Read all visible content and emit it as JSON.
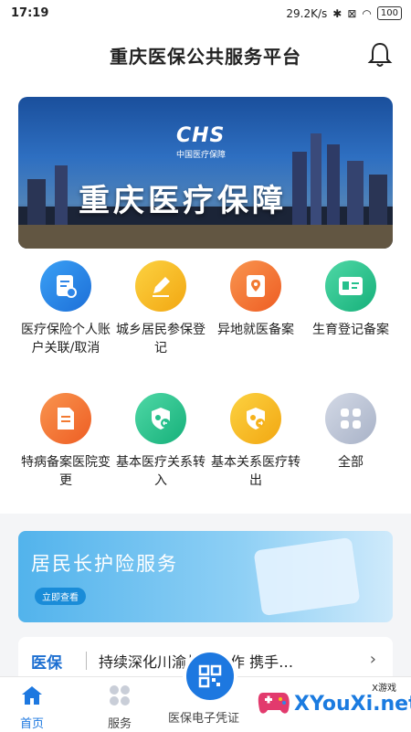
{
  "status_bar": {
    "time": "17:19",
    "speed": "29.2K/s",
    "battery": "100"
  },
  "header": {
    "title": "重庆医保公共服务平台"
  },
  "banner": {
    "logo": "CHS",
    "logo_sub": "中国医疗保障",
    "headline": "重庆医疗保障"
  },
  "services": [
    {
      "label": "医疗保险个人账户关联/取消",
      "icon": "document-link-icon",
      "color": "#2f86e8"
    },
    {
      "label": "城乡居民参保登记",
      "icon": "pencil-icon",
      "color": "#f6b21b"
    },
    {
      "label": "异地就医备案",
      "icon": "location-pin-icon",
      "color": "#f27a32"
    },
    {
      "label": "生育登记备案",
      "icon": "id-card-icon",
      "color": "#25c08c"
    },
    {
      "label": "特病备案医院变更",
      "icon": "file-edit-icon",
      "color": "#f27a32"
    },
    {
      "label": "基本医疗关系转入",
      "icon": "shield-transfer-in-icon",
      "color": "#25c08c"
    },
    {
      "label": "基本关系医疗转出",
      "icon": "shield-transfer-out-icon",
      "color": "#f6b21b"
    },
    {
      "label": "全部",
      "icon": "grid-all-icon",
      "color": "#b9c2d4"
    }
  ],
  "promo": {
    "title": "居民长护险服务",
    "button": "立即查看"
  },
  "news": {
    "tag": "医保",
    "text": "持续深化川渝战略合作 携手…"
  },
  "tabbar": {
    "home": "首页",
    "service": "服务",
    "voucher": "医保电子凭证"
  },
  "watermark": {
    "text": "XYouXi.net",
    "small": "X游戏"
  }
}
